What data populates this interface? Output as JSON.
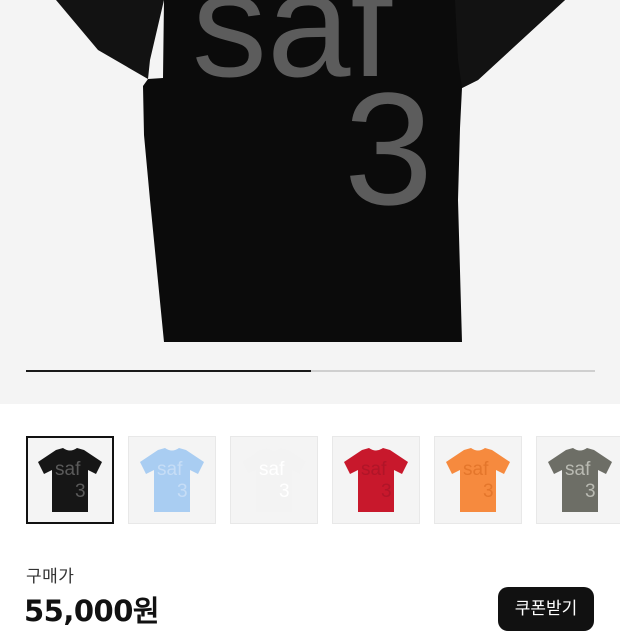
{
  "hero": {
    "print_line1": "saf",
    "print_line2": "3",
    "scroll_progress": 0.5
  },
  "thumbnails": [
    {
      "color": "#161616",
      "print_color": "#5a5a5a",
      "selected": true
    },
    {
      "color": "#a9cdf2",
      "print_color": "#c6ddf6",
      "selected": false
    },
    {
      "color": "#f3f3f3",
      "print_color": "#ffffff",
      "selected": false
    },
    {
      "color": "#c8182c",
      "print_color": "#b01528",
      "selected": false
    },
    {
      "color": "#f68a3e",
      "print_color": "#e4762b",
      "selected": false
    },
    {
      "color": "#6d6e66",
      "print_color": "#b9bab2",
      "selected": false
    }
  ],
  "thumb_print": {
    "line1": "saf",
    "line2": "3"
  },
  "price": {
    "label": "구매가",
    "value": "55,000원"
  },
  "coupon_button": {
    "label": "쿠폰받기"
  }
}
